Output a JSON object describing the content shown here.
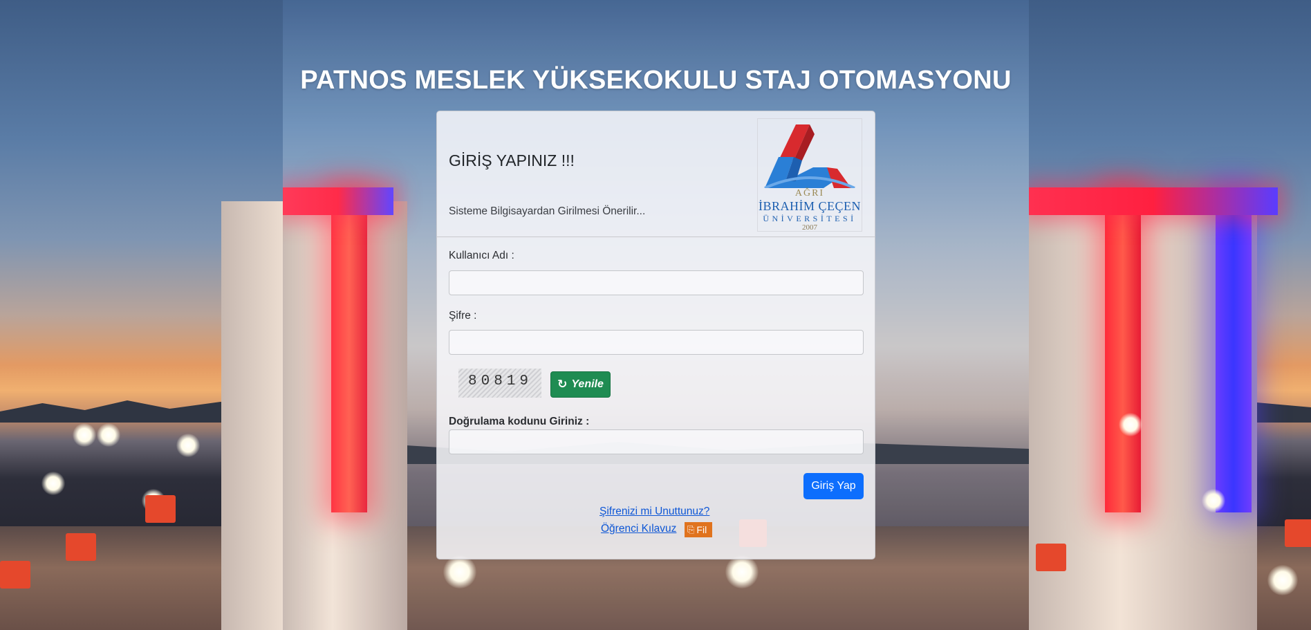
{
  "header": {
    "title": "PATNOS MESLEK YÜKSEKOKULU STAJ OTOMASYONU"
  },
  "login_card": {
    "title": "GİRİŞ YAPINIZ !!!",
    "subtitle": "Sisteme Bilgisayardan Girilmesi Önerilir...",
    "logo": {
      "line1": "AĞRI",
      "line2": "İBRAHİM ÇEÇEN",
      "line3": "ÜNİVERSİTESİ",
      "year": "2007"
    },
    "username_label": "Kullanıcı Adı :",
    "username_value": "",
    "password_label": "Şifre :",
    "password_value": "",
    "captcha_text": "80819",
    "refresh_label": "Yenile",
    "verification_label": "Doğrulama kodunu Giriniz :",
    "verification_value": "",
    "login_button": "Giriş Yap",
    "forgot_password_link": "Şifrenizi mi Unuttunuz?",
    "student_guide_link": "Öğrenci Kılavuz",
    "file_badge": "Fil"
  },
  "colors": {
    "primary_button": "#0d6efd",
    "refresh_button": "#1f8c52",
    "file_badge": "#e0731e",
    "link": "#0d56d6"
  },
  "icons": {
    "refresh": "refresh-icon",
    "file": "file-icon"
  }
}
